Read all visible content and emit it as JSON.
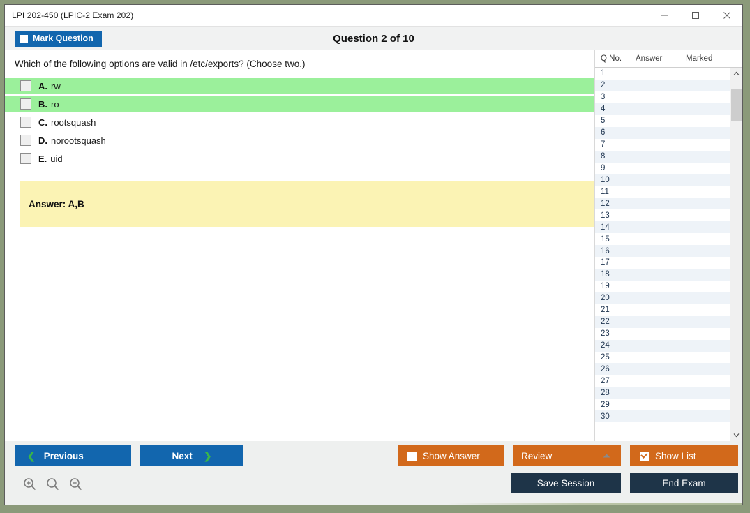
{
  "window": {
    "title": "LPI 202-450 (LPIC-2 Exam 202)",
    "minimize_label": "–",
    "maximize_label": "□",
    "close_label": "✕"
  },
  "header": {
    "mark_question_label": "Mark Question",
    "question_title": "Question 2 of 10"
  },
  "question": {
    "text": "Which of the following options are valid in /etc/exports? (Choose two.)",
    "options": [
      {
        "letter": "A.",
        "text": "rw",
        "correct": true
      },
      {
        "letter": "B.",
        "text": "ro",
        "correct": true
      },
      {
        "letter": "C.",
        "text": "rootsquash",
        "correct": false
      },
      {
        "letter": "D.",
        "text": "norootsquash",
        "correct": false
      },
      {
        "letter": "E.",
        "text": "uid",
        "correct": false
      }
    ],
    "answer_label": "Answer: A,B"
  },
  "list": {
    "columns": [
      "Q No.",
      "Answer",
      "Marked"
    ],
    "rows": [
      {
        "no": "1",
        "answer": "",
        "marked": ""
      },
      {
        "no": "2",
        "answer": "",
        "marked": ""
      },
      {
        "no": "3",
        "answer": "",
        "marked": ""
      },
      {
        "no": "4",
        "answer": "",
        "marked": ""
      },
      {
        "no": "5",
        "answer": "",
        "marked": ""
      },
      {
        "no": "6",
        "answer": "",
        "marked": ""
      },
      {
        "no": "7",
        "answer": "",
        "marked": ""
      },
      {
        "no": "8",
        "answer": "",
        "marked": ""
      },
      {
        "no": "9",
        "answer": "",
        "marked": ""
      },
      {
        "no": "10",
        "answer": "",
        "marked": ""
      },
      {
        "no": "11",
        "answer": "",
        "marked": ""
      },
      {
        "no": "12",
        "answer": "",
        "marked": ""
      },
      {
        "no": "13",
        "answer": "",
        "marked": ""
      },
      {
        "no": "14",
        "answer": "",
        "marked": ""
      },
      {
        "no": "15",
        "answer": "",
        "marked": ""
      },
      {
        "no": "16",
        "answer": "",
        "marked": ""
      },
      {
        "no": "17",
        "answer": "",
        "marked": ""
      },
      {
        "no": "18",
        "answer": "",
        "marked": ""
      },
      {
        "no": "19",
        "answer": "",
        "marked": ""
      },
      {
        "no": "20",
        "answer": "",
        "marked": ""
      },
      {
        "no": "21",
        "answer": "",
        "marked": ""
      },
      {
        "no": "22",
        "answer": "",
        "marked": ""
      },
      {
        "no": "23",
        "answer": "",
        "marked": ""
      },
      {
        "no": "24",
        "answer": "",
        "marked": ""
      },
      {
        "no": "25",
        "answer": "",
        "marked": ""
      },
      {
        "no": "26",
        "answer": "",
        "marked": ""
      },
      {
        "no": "27",
        "answer": "",
        "marked": ""
      },
      {
        "no": "28",
        "answer": "",
        "marked": ""
      },
      {
        "no": "29",
        "answer": "",
        "marked": ""
      },
      {
        "no": "30",
        "answer": "",
        "marked": ""
      }
    ]
  },
  "footer": {
    "previous_label": "Previous",
    "next_label": "Next",
    "show_answer_label": "Show Answer",
    "show_answer_checked": false,
    "review_label": "Review",
    "show_list_label": "Show List",
    "show_list_checked": true,
    "save_session_label": "Save Session",
    "end_exam_label": "End Exam"
  },
  "colors": {
    "accent_blue": "#1266ae",
    "accent_orange": "#d2691b",
    "dark_navy": "#1e3448",
    "correct_green": "#9bf09b",
    "answer_yellow": "#fbf3b4",
    "chevron_green": "#39b54a"
  }
}
